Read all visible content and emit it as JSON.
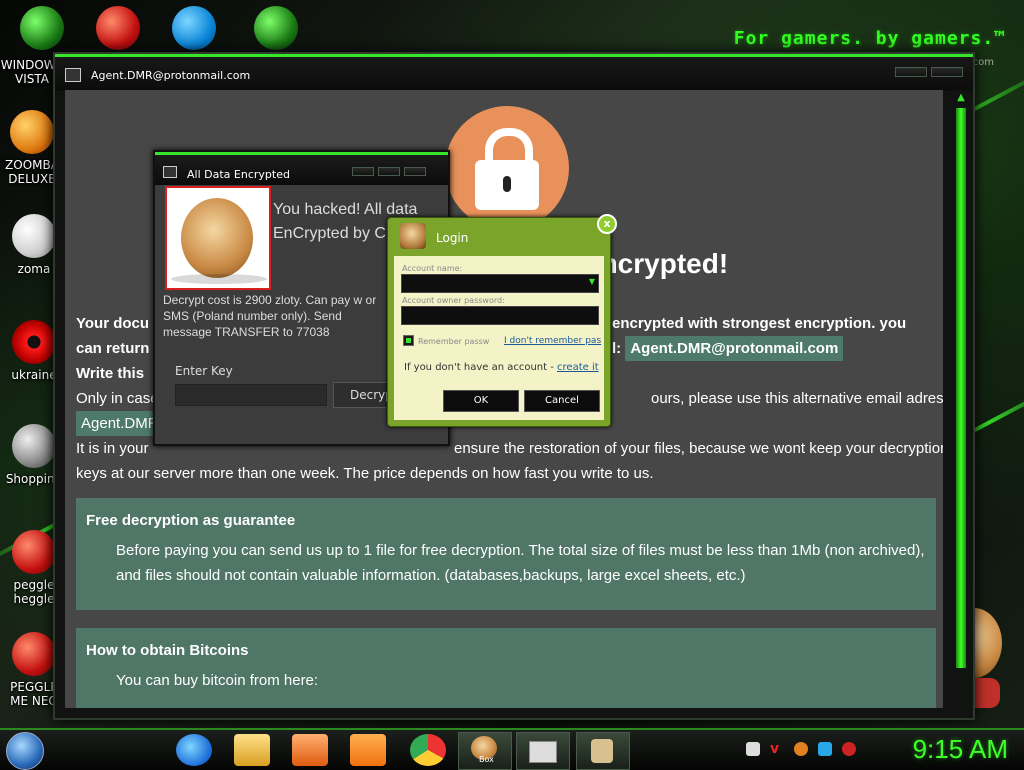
{
  "desktop": {
    "brand": "For gamers. by gamers.™",
    "brand_suffix": ".com",
    "icons": [
      {
        "label": "WINDOWS VISTA",
        "icon": "vista-orb-icon"
      },
      {
        "label": "ZOOMBA DELUXE",
        "icon": "zoomba-icon"
      },
      {
        "label": "zoma",
        "icon": "flower-icon"
      },
      {
        "label": "ukraine",
        "icon": "radiation-icon"
      },
      {
        "label": "Shopping",
        "icon": "flash-icon"
      },
      {
        "label": "peggle heggle",
        "icon": "peggle-icon"
      },
      {
        "label": "PEGGLE ME NEO",
        "icon": "peggle-icon"
      }
    ],
    "top_icons": [
      "vista-orb-icon",
      "peggle-icon",
      "skype-icon",
      "vista-orb-icon"
    ]
  },
  "main_window": {
    "title": "Agent.DMR@protonmail.com",
    "headline": "encrypted!",
    "intro_line1_start": "Your docu",
    "intro_line1_end": "encrypted with strongest encryption. you",
    "intro_line2_start": "can return",
    "intro_line2_mid": "l:",
    "email": "Agent.DMR@protonmail.com",
    "write_line": "Write this",
    "only_line_start": "Only in case",
    "only_line_end": "ours, please use this alternative email adress:",
    "alt_email_partial": "Agent.DMR",
    "interest_line1_start": "It is in your",
    "interest_line1_end": "ensure the restoration of your files, because we wont keep your decryption",
    "interest_line2": "keys at our server more than one week. The price depends on how fast you write to us.",
    "free_title": "Free decryption as guarantee",
    "free_line1": "Before paying you can send us up to 1 file for free decryption. The total size of files must be less than 1Mb (non archived),",
    "free_line2": "and files should not contain valuable information. (databases,backups, large excel sheets, etc.)",
    "bitcoin_title": "How to obtain Bitcoins",
    "bitcoin_line1": "You can buy bitcoin from here:"
  },
  "chomik_dialog": {
    "title": "All Data Encrypted",
    "message": "You hacked! All data EnCrypted by ChomIk",
    "cost": "Decrypt cost is 2900 zloty. Can pay w or SMS (Poland number only). Send message TRANSFER to 77038",
    "enter_key_label": "Enter Key",
    "enter_key_value": "",
    "decrypt_label": "Decrypt"
  },
  "login_dialog": {
    "title": "Login",
    "close": "x",
    "account_name_label": "Account name:",
    "account_name_value": "",
    "password_label": "Account owner password:",
    "password_value": "",
    "remember_label": "Remember passw",
    "remember_checked": true,
    "forgot_link": "I don't remember pas",
    "no_account_text": "If you don't have an account -",
    "create_link": "create it",
    "ok_label": "OK",
    "cancel_label": "Cancel"
  },
  "taskbar": {
    "apps": [
      "ie-icon",
      "file-explorer-icon",
      "media-player-icon",
      "uc-browser-icon",
      "chrome-icon",
      "hamster-box-icon",
      "window-icon",
      "app-icon"
    ],
    "active_app_label": "Box",
    "clock": "9:15 AM"
  }
}
